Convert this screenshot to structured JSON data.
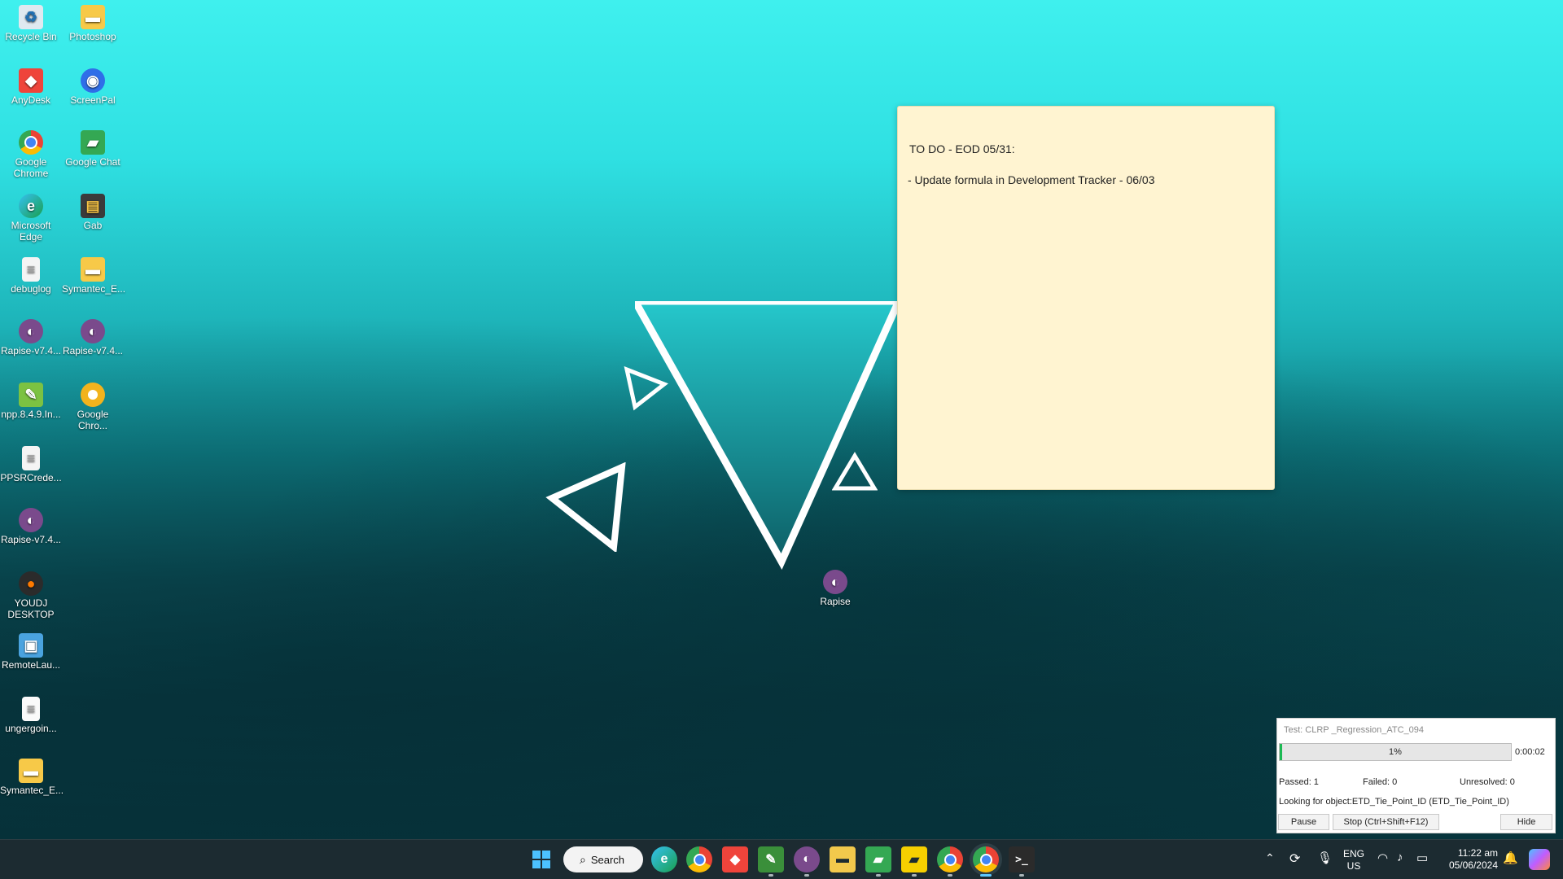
{
  "desktop_icons": [
    {
      "label": "Recycle Bin",
      "icon": "recycle-bin-icon"
    },
    {
      "label": "Photoshop",
      "icon": "folder-icon"
    },
    {
      "label": "AnyDesk",
      "icon": "anydesk-icon"
    },
    {
      "label": "ScreenPal",
      "icon": "screenpal-icon"
    },
    {
      "label": "Google Chrome",
      "icon": "chrome-icon"
    },
    {
      "label": "Google Chat",
      "icon": "google-chat-icon"
    },
    {
      "label": "Microsoft Edge",
      "icon": "edge-icon"
    },
    {
      "label": "Gab",
      "icon": "gab-icon"
    },
    {
      "label": "debuglog",
      "icon": "document-icon"
    },
    {
      "label": "Symantec_E...",
      "icon": "folder-icon"
    },
    {
      "label": "Rapise-v7.4...",
      "icon": "rapise-icon"
    },
    {
      "label": "Rapise-v7.4...",
      "icon": "rapise-icon"
    },
    {
      "label": "npp.8.4.9.In...",
      "icon": "notepadpp-icon"
    },
    {
      "label": "Google Chro...",
      "icon": "chrome-canary-icon"
    },
    {
      "label": "PPSRCrede...",
      "icon": "document-icon"
    },
    {
      "label": "Rapise-v7.4...",
      "icon": "rapise-icon"
    },
    {
      "label": "YOUDJ DESKTOP",
      "icon": "youdj-icon"
    },
    {
      "label": "RemoteLau...",
      "icon": "remote-launcher-icon"
    },
    {
      "label": "ungergoin...",
      "icon": "document-icon"
    },
    {
      "label": "Symantec_E...",
      "icon": "folder-icon"
    },
    {
      "label": "Rapise",
      "icon": "rapise-icon"
    }
  ],
  "sticky_note": {
    "line1": "TO DO - EOD 05/31:",
    "line2": "- Update formula in Development Tracker - 06/03"
  },
  "test_runner": {
    "title": "Test: CLRP _Regression_ATC_094",
    "progress_text": "1%",
    "progress_value": 0.01,
    "elapsed": "0:00:02",
    "passed": "Passed: 1",
    "failed": "Failed: 0",
    "unresolved": "Unresolved: 0",
    "looking": "Looking for object:ETD_Tie_Point_ID (ETD_Tie_Point_ID)",
    "pause_label": "Pause",
    "stop_label": "Stop (Ctrl+Shift+F12)",
    "hide_label": "Hide"
  },
  "taskbar": {
    "search_label": "Search",
    "apps": [
      "windows-start-icon",
      "edge-icon",
      "chrome-icon",
      "anydesk-icon",
      "notepad-icon",
      "rapise-icon",
      "file-explorer-icon",
      "google-chat-icon",
      "sticky-notes-icon",
      "chrome-icon",
      "chrome-icon",
      "terminal-icon"
    ],
    "lang": "ENG",
    "region": "US",
    "time": "11:22 am",
    "date": "05/06/2024"
  },
  "colors": {
    "accent": "#1db954",
    "sticky": "#fff4d1",
    "taskbar": "#1c2b31"
  }
}
